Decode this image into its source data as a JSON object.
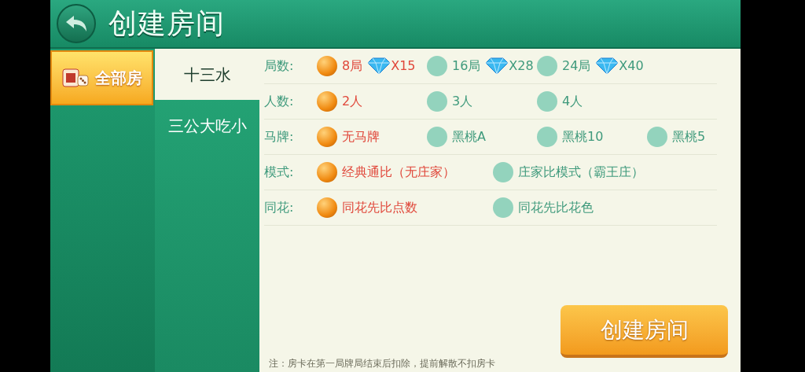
{
  "header": {
    "title": "创建房间"
  },
  "categories": [
    {
      "label": "全部房",
      "selected": true
    }
  ],
  "games": [
    {
      "label": "十三水",
      "selected": true
    },
    {
      "label": "三公大吃小",
      "selected": false
    }
  ],
  "settings": [
    {
      "label": "局数:",
      "options": [
        {
          "label": "8局",
          "cost": "X15",
          "selected": true
        },
        {
          "label": "16局",
          "cost": "X28",
          "selected": false
        },
        {
          "label": "24局",
          "cost": "X40",
          "selected": false
        }
      ]
    },
    {
      "label": "人数:",
      "options": [
        {
          "label": "2人",
          "selected": true
        },
        {
          "label": "3人",
          "selected": false
        },
        {
          "label": "4人",
          "selected": false
        }
      ]
    },
    {
      "label": "马牌:",
      "options": [
        {
          "label": "无马牌",
          "selected": true
        },
        {
          "label": "黑桃A",
          "selected": false
        },
        {
          "label": "黑桃10",
          "selected": false
        },
        {
          "label": "黑桃5",
          "selected": false
        }
      ]
    },
    {
      "label": "模式:",
      "options": [
        {
          "label": "经典通比（无庄家）",
          "selected": true
        },
        {
          "label": "庄家比模式（霸王庄）",
          "selected": false
        }
      ]
    },
    {
      "label": "同花:",
      "options": [
        {
          "label": "同花先比点数",
          "selected": true
        },
        {
          "label": "同花先比花色",
          "selected": false
        }
      ]
    }
  ],
  "note": "注：房卡在第一局牌局结束后扣除，提前解散不扣房卡",
  "create_button": "创建房间"
}
